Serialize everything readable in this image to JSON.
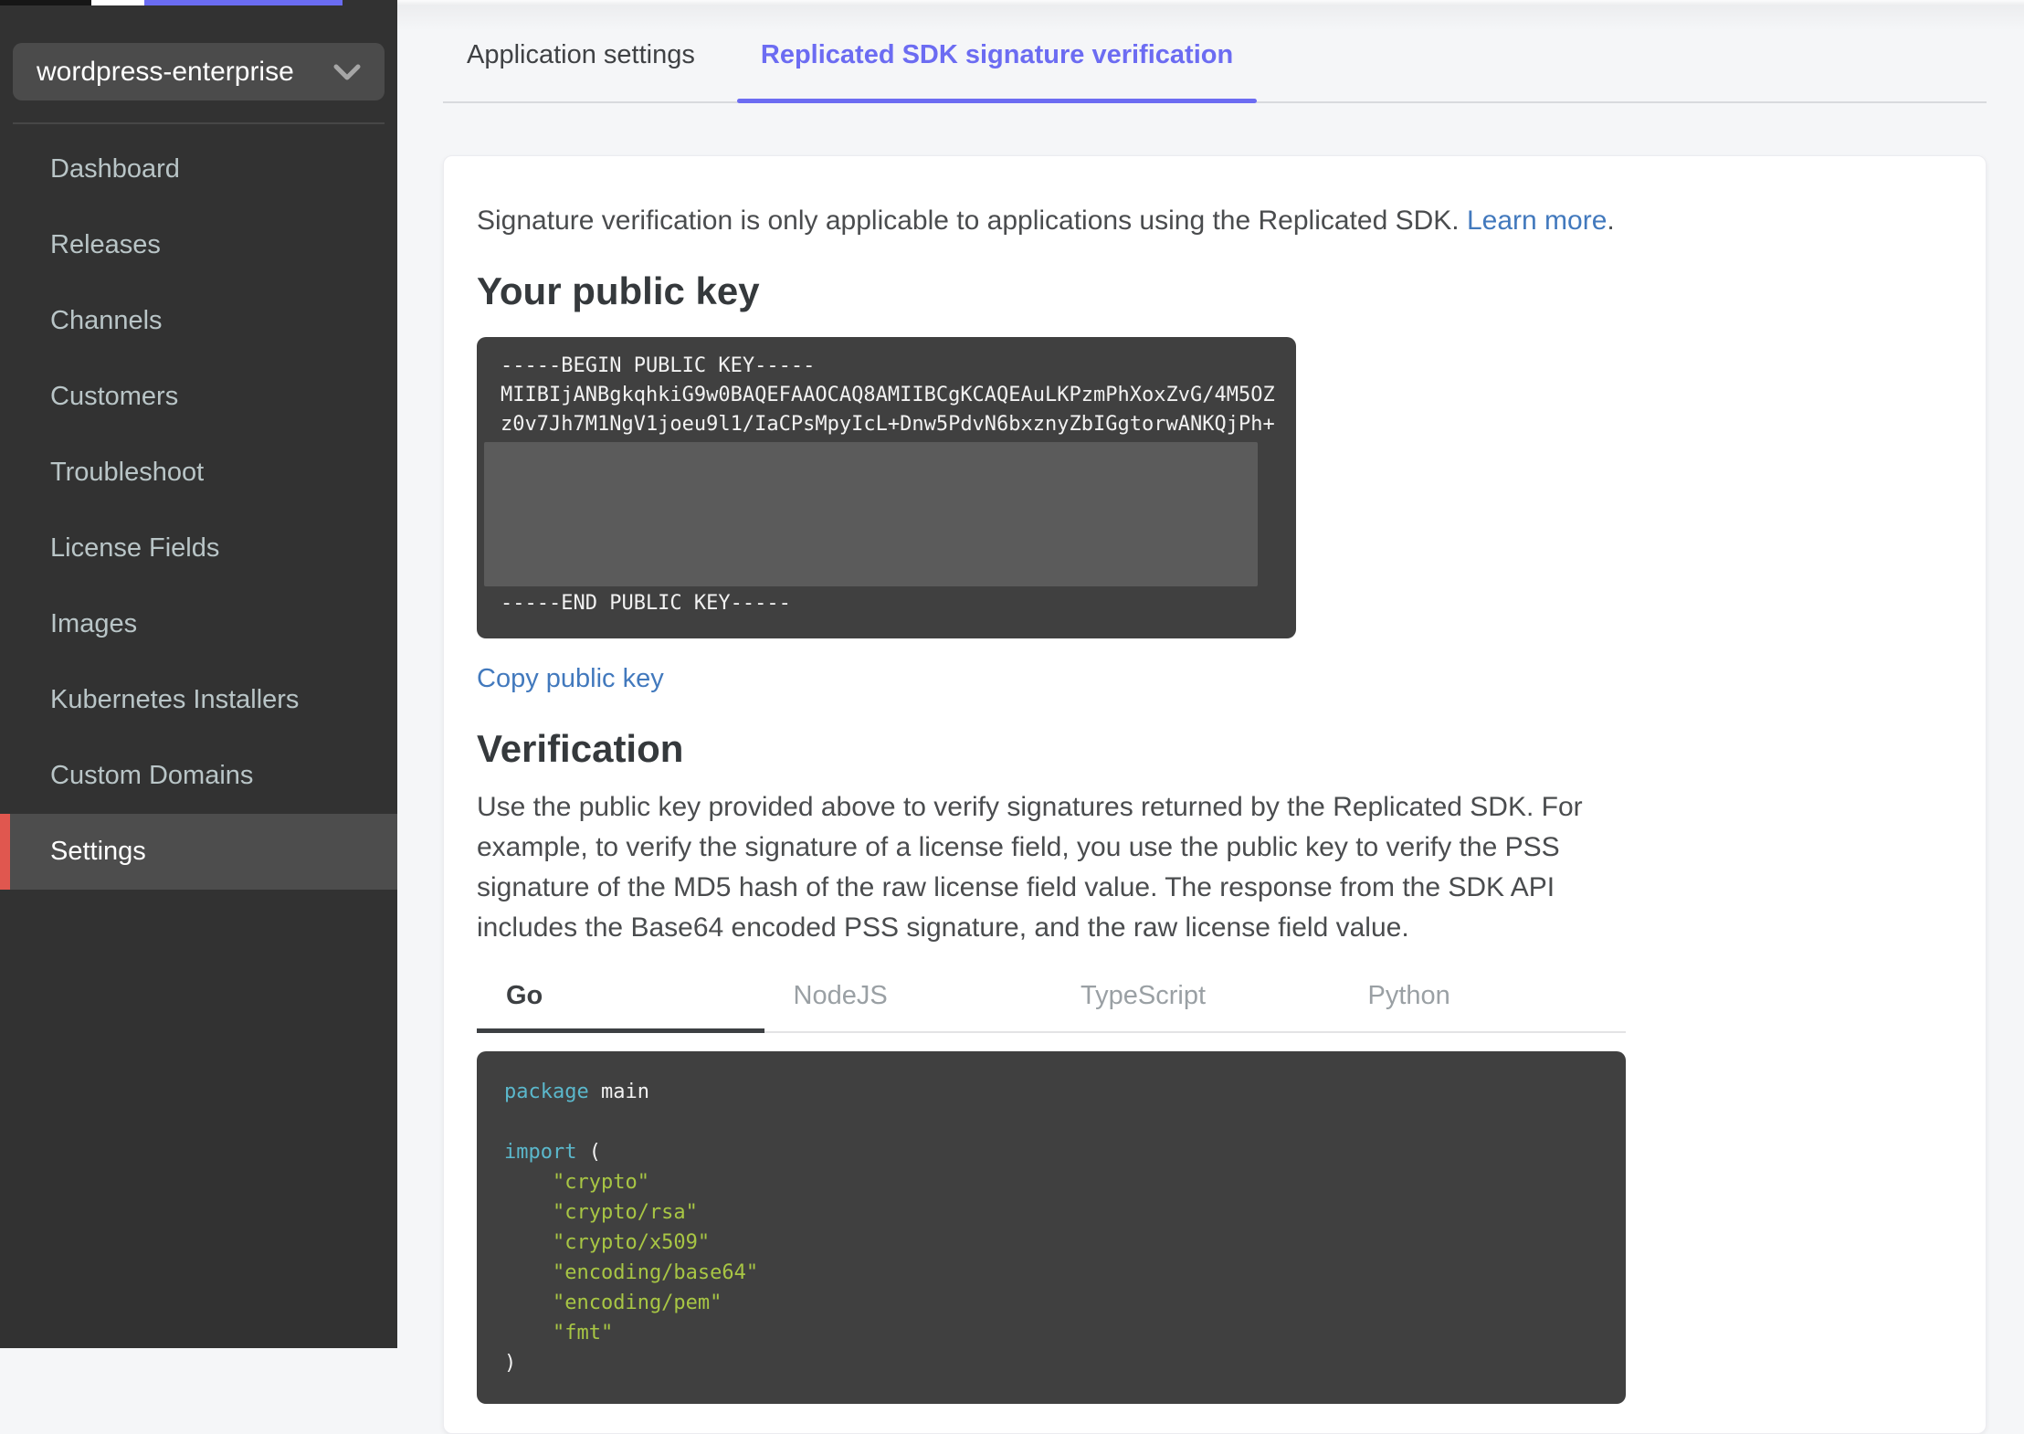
{
  "sidebar": {
    "app_selector": {
      "label": "wordpress-enterprise"
    },
    "items": [
      {
        "label": "Dashboard",
        "active": false
      },
      {
        "label": "Releases",
        "active": false
      },
      {
        "label": "Channels",
        "active": false
      },
      {
        "label": "Customers",
        "active": false
      },
      {
        "label": "Troubleshoot",
        "active": false
      },
      {
        "label": "License Fields",
        "active": false
      },
      {
        "label": "Images",
        "active": false
      },
      {
        "label": "Kubernetes Installers",
        "active": false
      },
      {
        "label": "Custom Domains",
        "active": false
      },
      {
        "label": "Settings",
        "active": true
      }
    ]
  },
  "tabs": [
    {
      "label": "Application settings",
      "active": false
    },
    {
      "label": "Replicated SDK signature verification",
      "active": true
    }
  ],
  "content": {
    "intro": {
      "text": "Signature verification is only applicable to applications using the Replicated SDK. ",
      "link_label": "Learn more",
      "suffix": "."
    },
    "public_key": {
      "heading": "Your public key",
      "lines": [
        "-----BEGIN PUBLIC KEY-----",
        "MIIBIjANBgkqhkiG9w0BAQEFAAOCAQ8AMIIBCgKCAQEAuLKPzmPhXoxZvG/4M5OZ",
        "z0v7Jh7M1NgV1joeu9l1/IaCPsMpyIcL+Dnw5PdvN6bxznyZbIGgtorwANKQjPh+"
      ],
      "end_line": "-----END PUBLIC KEY-----",
      "copy_label": "Copy public key"
    },
    "verification": {
      "heading": "Verification",
      "description": "Use the public key provided above to verify signatures returned by the Replicated SDK. For example, to verify the signature of a license field, you use the public key to verify the PSS signature of the MD5 hash of the raw license field value. The response from the SDK API includes the Base64 encoded PSS signature, and the raw license field value.",
      "languages": [
        "Go",
        "NodeJS",
        "TypeScript",
        "Python"
      ],
      "active_language": "Go"
    }
  },
  "go_code": {
    "package_kw": "package",
    "package_rest": " main",
    "import_kw": "import",
    "import_rest": " (",
    "imports": [
      "    \"crypto\"",
      "    \"crypto/rsa\"",
      "    \"crypto/x509\"",
      "    \"encoding/base64\"",
      "    \"encoding/pem\"",
      "    \"fmt\""
    ],
    "close_paren": ")"
  },
  "colors": {
    "accent_purple": "#6c6cf2",
    "accent_red": "#e0574f",
    "link_blue": "#4279bd",
    "sidebar_bg": "#323232",
    "sidebar_active_bg": "#4d4d4d",
    "code_bg": "#404040",
    "code_keyword": "#5bb8cc",
    "code_string": "#a8c644",
    "redacted_gray": "#5b5b5b"
  }
}
